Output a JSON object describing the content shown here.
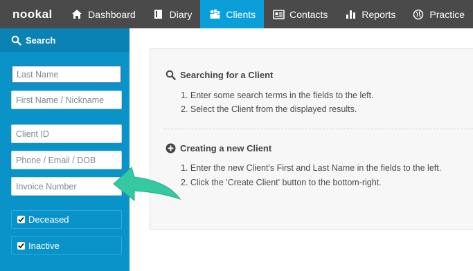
{
  "nav": {
    "logo": "nookal",
    "items": [
      {
        "label": "Dashboard",
        "icon": "home-icon"
      },
      {
        "label": "Diary",
        "icon": "book-icon"
      },
      {
        "label": "Clients",
        "icon": "people-icon",
        "active": true
      },
      {
        "label": "Contacts",
        "icon": "address-card-icon"
      },
      {
        "label": "Reports",
        "icon": "bar-chart-icon"
      },
      {
        "label": "Practice",
        "icon": "settings-globe-icon"
      }
    ]
  },
  "sidebar": {
    "title": "Search",
    "fields": {
      "last_name": "Last Name",
      "first_name": "First Name / Nickname",
      "client_id": "Client ID",
      "phone": "Phone / Email / DOB",
      "invoice": "Invoice Number"
    },
    "checks": {
      "deceased": "Deceased",
      "inactive": "Inactive"
    }
  },
  "panel": {
    "search_title": "Searching for a Client",
    "search_steps": [
      "1.  Enter some search terms in the fields to the left.",
      "2.  Select the Client from the displayed results."
    ],
    "create_title": "Creating a new Client",
    "create_steps": [
      "1.  Enter the new Client's First and Last Name in the fields to the left.",
      "2.  Click the 'Create Client' button to the bottom-right."
    ]
  },
  "colors": {
    "nav_bg": "#4a4a4a",
    "accent": "#0a9fd8",
    "sidebar_bg": "#0a93c9",
    "arrow": "#35c9a1"
  }
}
